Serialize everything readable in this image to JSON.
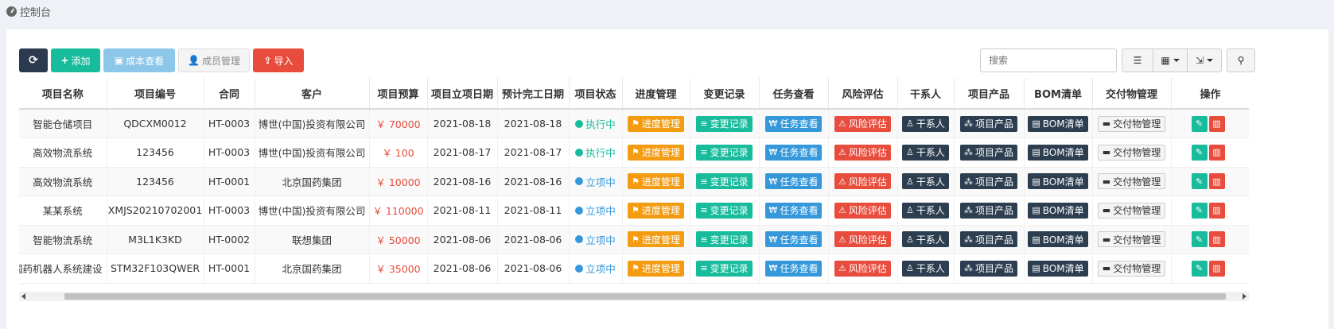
{
  "breadcrumb": {
    "title": "控制台",
    "icon": "dashboard-icon"
  },
  "toolbar": {
    "refresh_icon": "refresh-icon",
    "add_label": "添加",
    "cost_label": "成本查看",
    "member_label": "成员管理",
    "import_label": "导入",
    "search_placeholder": "搜索"
  },
  "colors": {
    "primary_dark": "#2b3a4e",
    "success": "#18bc9c",
    "danger": "#e74c3c",
    "warning": "#f39c12",
    "info": "#3498db",
    "dark": "#2c3e50"
  },
  "table": {
    "columns": [
      "项目名称",
      "项目编号",
      "合同",
      "客户",
      "项目预算",
      "项目立项日期",
      "预计完工日期",
      "项目状态",
      "进度管理",
      "变更记录",
      "任务查看",
      "风险评估",
      "干系人",
      "项目产品",
      "BOM清单",
      "交付物管理",
      "操作"
    ],
    "actions": {
      "progress": "进度管理",
      "change": "变更记录",
      "task": "任务查看",
      "risk": "风险评估",
      "stakeholder": "干系人",
      "product": "项目产品",
      "bom": "BOM清单",
      "delivery": "交付物管理"
    },
    "rows": [
      {
        "name": "智能仓储项目",
        "code": "QDCXM0012",
        "contract": "HT-0003",
        "customer": "博世(中国)投资有限公司",
        "budget": "￥ 70000",
        "start": "2021-08-18",
        "end": "2021-08-18",
        "status": "执行中",
        "status_color": "#18bc9c"
      },
      {
        "name": "高效物流系统",
        "code": "123456",
        "contract": "HT-0003",
        "customer": "博世(中国)投资有限公司",
        "budget": "￥ 100",
        "start": "2021-08-17",
        "end": "2021-08-17",
        "status": "执行中",
        "status_color": "#18bc9c"
      },
      {
        "name": "高效物流系统",
        "code": "123456",
        "contract": "HT-0001",
        "customer": "北京国药集团",
        "budget": "￥ 10000",
        "start": "2021-08-16",
        "end": "2021-08-16",
        "status": "立项中",
        "status_color": "#3498db"
      },
      {
        "name": "某某系统",
        "code": "XMJS20210702001",
        "contract": "HT-0003",
        "customer": "博世(中国)投资有限公司",
        "budget": "￥ 110000",
        "start": "2021-08-11",
        "end": "2021-08-11",
        "status": "立项中",
        "status_color": "#3498db"
      },
      {
        "name": "智能物流系统",
        "code": "M3L1K3KD",
        "contract": "HT-0002",
        "customer": "联想集团",
        "budget": "￥ 50000",
        "start": "2021-08-06",
        "end": "2021-08-06",
        "status": "立项中",
        "status_color": "#3498db"
      },
      {
        "name": "国药机器人系统建设",
        "code": "STM32F103QWER",
        "contract": "HT-0001",
        "customer": "北京国药集团",
        "budget": "￥ 35000",
        "start": "2021-08-06",
        "end": "2021-08-06",
        "status": "立项中",
        "status_color": "#3498db"
      }
    ]
  }
}
